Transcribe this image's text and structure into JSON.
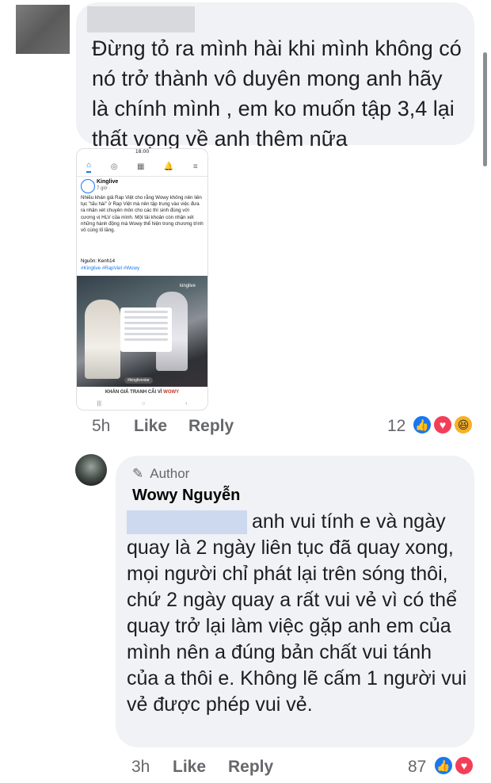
{
  "comment1": {
    "text": "Đừng tỏ ra mình hài khi mình không có nó trở thành vô duyên mong anh hãy là chính mình , em ko muốn tập 3,4 lại thất vọng về anh thêm nữa",
    "time": "5h",
    "like_label": "Like",
    "reply_label": "Reply",
    "reaction_count": "12"
  },
  "screenshot": {
    "status_time": "18:00",
    "page_name": "Kinglive",
    "post_time": "7 giờ ·",
    "post_text": "Nhiều khán giả Rap Việt cho rằng Wowy không nên liên tục \"tấu hài\" ở Rap Việt mà nên tập trung vào việc đưa ra nhận xét chuyên môn cho các thí sinh đúng với cương vị HLV của mình. Một tài khoản còn nhận xét những hành động mà Wowy thể hiện trong chương trình vô cùng lố lăng.",
    "source": "Nguồn: Kenh14",
    "hashtags": "#Kinglive #RapViet #Wowy",
    "watermark": "kinglive",
    "photo_tag": "#kinglivestar",
    "caption_prefix": "KHÁN GIẢ TRANH CÃI VÌ",
    "caption_highlight": "WOWY"
  },
  "comment2": {
    "author_badge": "Author",
    "author_name": "Wowy Nguyễn",
    "text": "anh vui tính e và ngày quay là 2 ngày liên tục đã quay xong, mọi người chỉ phát lại trên sóng thôi, chứ 2 ngày quay a rất vui vẻ vì có thể quay trở lại làm việc gặp anh em của mình nên a đúng bản chất vui tánh của a thôi e. Không lẽ cấm 1 người vui vẻ được phép vui vẻ.",
    "time": "3h",
    "like_label": "Like",
    "reply_label": "Reply",
    "reaction_count": "87"
  },
  "colors": {
    "bubble": "#f0f2f5",
    "meta_gray": "#65676b",
    "like_blue": "#1877f2",
    "love_red": "#f33e58",
    "haha_yellow": "#f7b125"
  }
}
